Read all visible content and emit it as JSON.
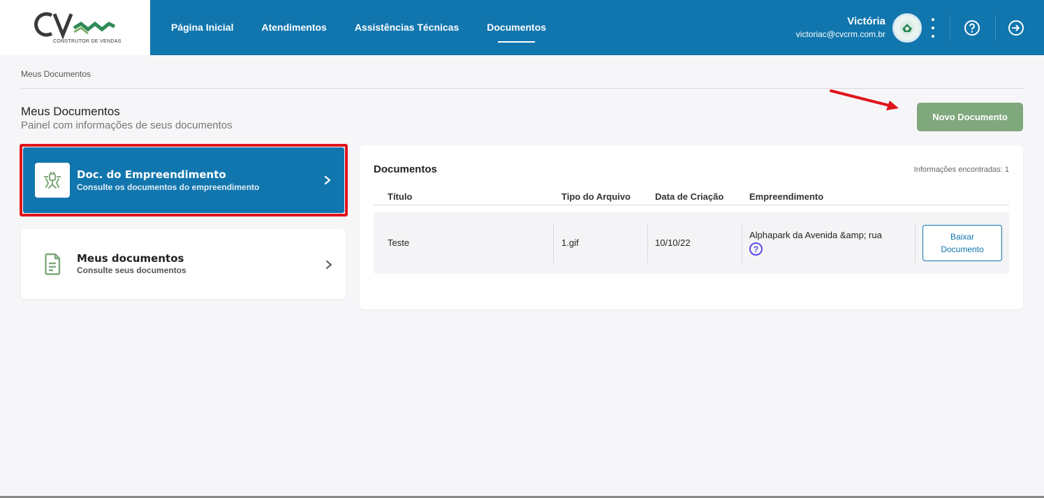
{
  "header": {
    "logo_text": "CV",
    "logo_subtitle": "CONSTRUTOR DE VENDAS",
    "nav": [
      {
        "label": "Página Inicial"
      },
      {
        "label": "Atendimentos"
      },
      {
        "label": "Assistências Técnicas"
      },
      {
        "label": "Documentos"
      }
    ],
    "active_nav": "Documentos",
    "user_name": "Victória",
    "user_email": "victoriac@cvcrm.com.br",
    "icons": [
      "avatar-icon",
      "kebab-menu-icon",
      "help-icon",
      "logout-icon"
    ]
  },
  "breadcrumb": "Meus Documentos",
  "page": {
    "title": "Meus Documentos",
    "subtitle": "Painel com informações de seus documentos",
    "new_button": "Novo Documento"
  },
  "cards": [
    {
      "title": "Doc. do Empreendimento",
      "desc": "Consulte os documentos do empreendimento",
      "icon": "building-plug-icon"
    },
    {
      "title": "Meus documentos",
      "desc": "Consulte seus documentos",
      "icon": "document-icon"
    }
  ],
  "documents": {
    "title": "Documentos",
    "count": "Informações encontradas: 1",
    "columns": [
      "Título",
      "Tipo do Arquivo",
      "Data de Criação",
      "Empreendimento"
    ],
    "rows": [
      {
        "titulo": "Teste",
        "tipo": "1.gif",
        "data": "10/10/22",
        "empreendimento": "Alphapark da Avenida &amp; rua",
        "action": "Baixar Documento"
      }
    ]
  },
  "colors": {
    "primary": "#1176ae",
    "accent_green": "#7fa87c",
    "highlight_red": "#e0141c",
    "help_purple": "#5b4ce8"
  }
}
